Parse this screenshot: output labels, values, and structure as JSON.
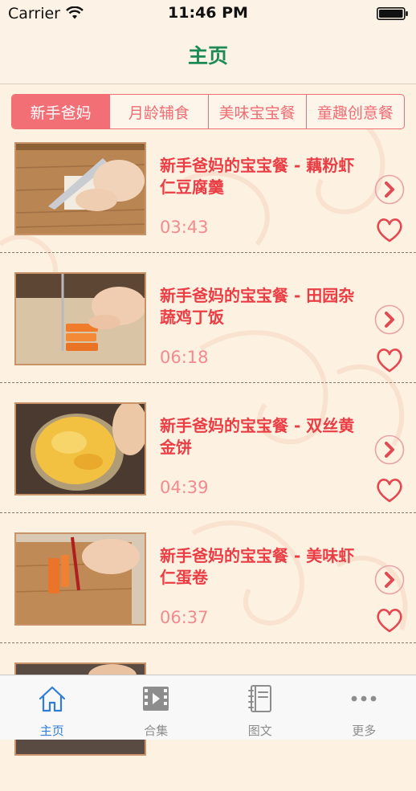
{
  "status_bar": {
    "carrier": "Carrier",
    "time": "11:46 PM"
  },
  "nav": {
    "title": "主页"
  },
  "segments": [
    {
      "label": "新手爸妈",
      "active": true
    },
    {
      "label": "月龄辅食",
      "active": false
    },
    {
      "label": "美味宝宝餐",
      "active": false
    },
    {
      "label": "童趣创意餐",
      "active": false
    }
  ],
  "videos": [
    {
      "title": "新手爸妈的宝宝餐 - 藕粉虾仁豆腐羹",
      "duration": "03:43"
    },
    {
      "title": "新手爸妈的宝宝餐 - 田园杂蔬鸡丁饭",
      "duration": "06:18"
    },
    {
      "title": "新手爸妈的宝宝餐 - 双丝黄金饼",
      "duration": "04:39"
    },
    {
      "title": "新手爸妈的宝宝餐 - 美味虾仁蛋卷",
      "duration": "06:37"
    }
  ],
  "tabs": [
    {
      "label": "主页",
      "icon": "home-icon",
      "active": true
    },
    {
      "label": "合集",
      "icon": "film-icon",
      "active": false
    },
    {
      "label": "图文",
      "icon": "notebook-icon",
      "active": false
    },
    {
      "label": "更多",
      "icon": "more-icon",
      "active": false
    }
  ],
  "colors": {
    "accent": "#f26f75",
    "title_text": "#ea3e45",
    "nav_title": "#1e8a56",
    "tab_active": "#2f7dd8",
    "background": "#fdf1e2"
  }
}
